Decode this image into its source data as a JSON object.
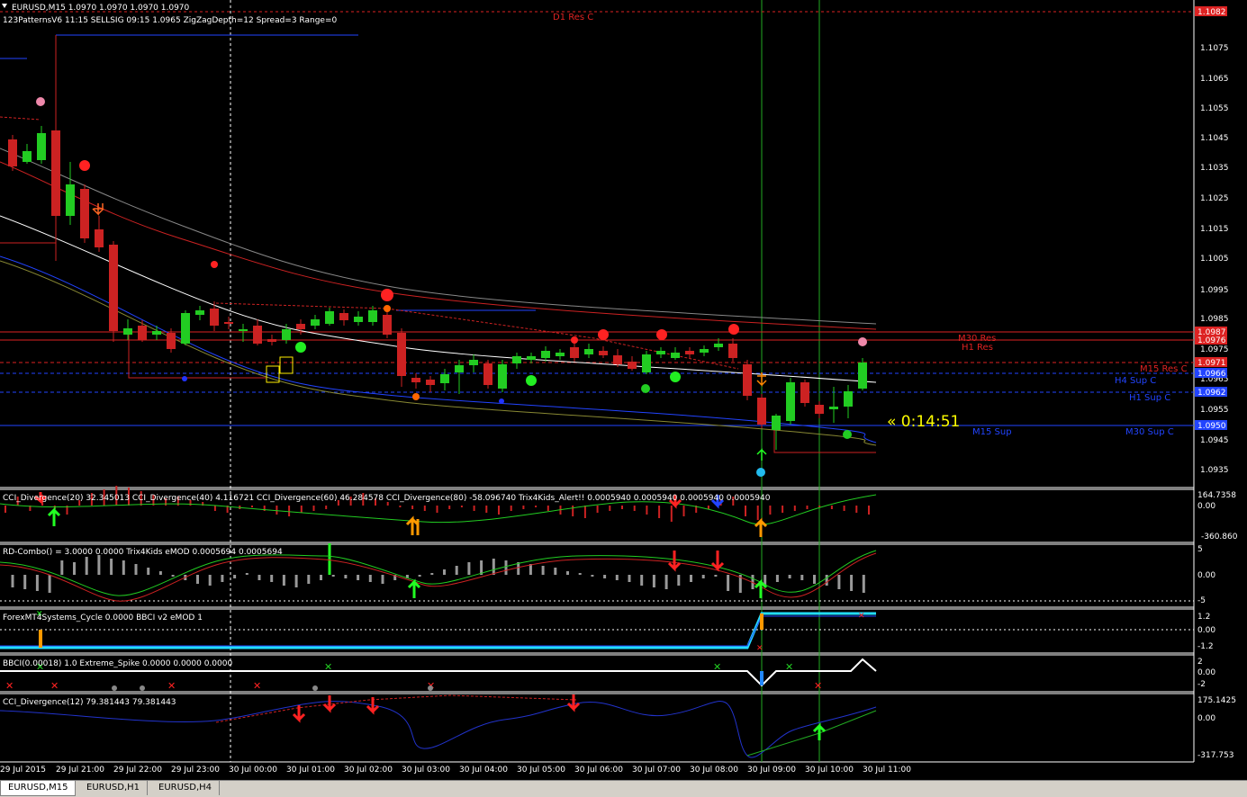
{
  "header": {
    "symbol_line": "EURUSD,M15  1.0970 1.0970 1.0970 1.0970",
    "indicator_line": "123PatternsV6  11:15  SELLSIG  09:15  1.0965  ZigZagDepth=12  Spread=3  Range=0"
  },
  "price_axis": {
    "labels": [
      "1.1075",
      "1.1065",
      "1.1055",
      "1.1045",
      "1.1035",
      "1.1025",
      "1.1015",
      "1.1005",
      "1.0995",
      "1.0985",
      "1.0975",
      "1.0965",
      "1.0955",
      "1.0945",
      "1.0935"
    ],
    "boxes": [
      "1.1082",
      "1.0987",
      "1.0976",
      "1.0971",
      "1.0966",
      "1.0962",
      "1.0950"
    ]
  },
  "level_labels": {
    "d1_res": "D1 Res C",
    "m30_res": "M30 Res",
    "h1_res": "H1 Res",
    "m15_res": "M15 Res C",
    "h4_sup": "H4 Sup C",
    "h1_sup": "H1 Sup C",
    "m15_sup": "M15 Sup",
    "m30_sup": "M30 Sup C"
  },
  "timer": "« 0:14:51",
  "panels": {
    "p1": {
      "title": "CCI_Divergence(20) 32.345013  CCI_Divergence(40) 4.116721  CCI_Divergence(60) 46.284578  CCI_Divergence(80) -58.096740  Trix4Kids_Alert!! 0.0005940 0.0005940 0.0005940 0.0005940",
      "scale": [
        "164.7358",
        "0.00",
        "-360.860"
      ]
    },
    "p2": {
      "title": "RD-Combo() = 3.0000 0.0000  Trix4Kids eMOD 0.0005694 0.0005694",
      "scale": [
        "5",
        "0.00",
        "-5"
      ]
    },
    "p3": {
      "title": "ForexMT4Systems_Cycle 0.0000  BBCI v2 eMOD 1",
      "scale": [
        "1.2",
        "0.00",
        "-1.2"
      ]
    },
    "p4": {
      "title": "BBCI(0.00018) 1.0  Extreme_Spike 0.0000 0.0000 0.0000",
      "scale": [
        "2",
        "0.00",
        "-2"
      ]
    },
    "p5": {
      "title": "CCI_Divergence(12) 79.381443 79.381443",
      "scale": [
        "175.1425",
        "0.00",
        "-317.753"
      ]
    }
  },
  "time_axis": [
    "29 Jul 2015",
    "29 Jul 21:00",
    "29 Jul 22:00",
    "29 Jul 23:00",
    "30 Jul 00:00",
    "30 Jul 01:00",
    "30 Jul 02:00",
    "30 Jul 03:00",
    "30 Jul 04:00",
    "30 Jul 05:00",
    "30 Jul 06:00",
    "30 Jul 07:00",
    "30 Jul 08:00",
    "30 Jul 09:00",
    "30 Jul 10:00",
    "30 Jul 11:00"
  ],
  "tabs": [
    "EURUSD,M15",
    "EURUSD,H1",
    "EURUSD,H4"
  ],
  "colors": {
    "bull": "#22cc22",
    "bear": "#cc2222",
    "res": "#dd2222",
    "sup": "#2244ff",
    "timer": "#ffff00",
    "grid": "#ffffff",
    "vline": "#22aa22"
  }
}
